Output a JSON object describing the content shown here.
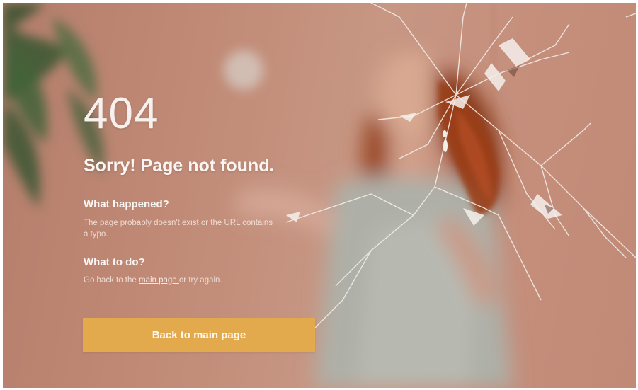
{
  "error": {
    "code": "404",
    "headline": "Sorry! Page not found."
  },
  "what_happened": {
    "title": "What happened?",
    "text": "The page probably doesn't exist or the URL contains a typo."
  },
  "what_to_do": {
    "title": "What to do?",
    "text_before": "Go back to the ",
    "link_label": "main page ",
    "text_after": "or try again."
  },
  "actions": {
    "back_button_label": "Back to main page"
  },
  "colors": {
    "background": "#c08a76",
    "button": "#e2aa4c",
    "text": "#ffffff"
  },
  "background_image": "blurred woman in grey dress behind shattered glass, plant at left"
}
